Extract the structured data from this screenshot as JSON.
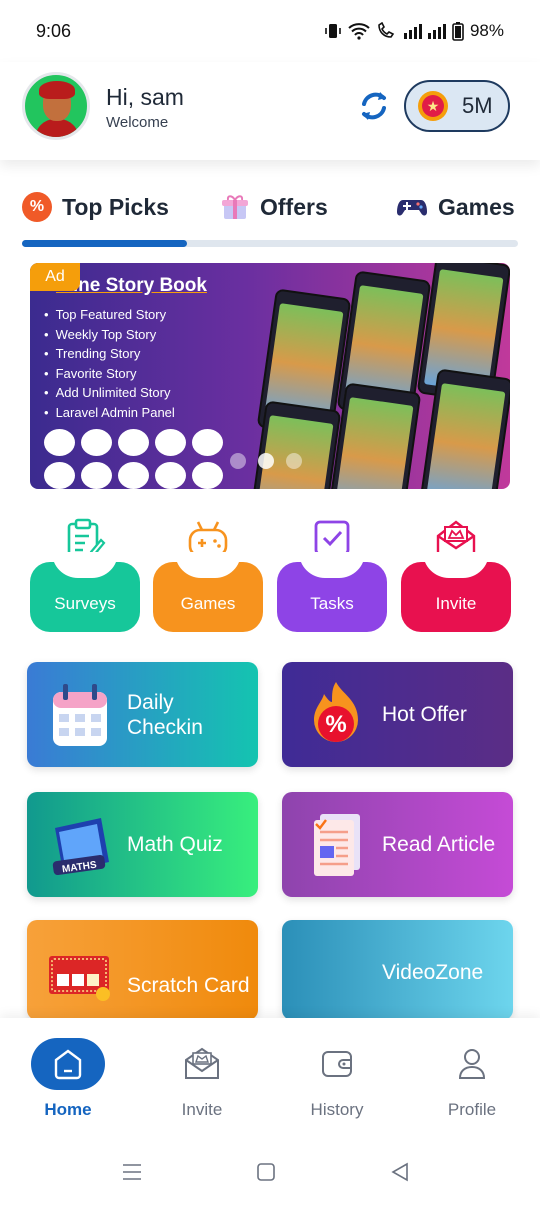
{
  "status_bar": {
    "time": "9:06",
    "battery": "98%"
  },
  "header": {
    "greeting": "Hi, sam",
    "subtitle": "Welcome",
    "coins": "5M"
  },
  "tabs": [
    {
      "label": "Top Picks",
      "icon": "percent-badge-icon",
      "active": true
    },
    {
      "label": "Offers",
      "icon": "gift-icon",
      "active": false
    },
    {
      "label": "Games",
      "icon": "gamepad-icon",
      "active": false
    }
  ],
  "banner": {
    "badge": "Ad",
    "title": "nline Story Book",
    "features": [
      "Top Featured Story",
      "Weekly Top Story",
      "Trending Story",
      "Favorite Story",
      "Add Unlimited Story",
      "Laravel Admin Panel"
    ]
  },
  "quick_actions": [
    {
      "label": "Surveys",
      "color": "#16c79a"
    },
    {
      "label": "Games",
      "color": "#f7931e"
    },
    {
      "label": "Tasks",
      "color": "#8e44e6"
    },
    {
      "label": "Invite",
      "color": "#e8114f"
    }
  ],
  "cards": [
    {
      "label": "Daily Checkin",
      "from": "#3a7bd5",
      "to": "#14c4b0"
    },
    {
      "label": "Hot Offer",
      "from": "#3f2b96",
      "to": "#5b2d86"
    },
    {
      "label": "Math Quiz",
      "from": "#11998e",
      "to": "#38ef7d"
    },
    {
      "label": "Read Article",
      "from": "#8e44ad",
      "to": "#c54bd6"
    },
    {
      "label": "Scratch Card",
      "from": "#f7a13a",
      "to": "#f08a0c"
    },
    {
      "label": "VideoZone",
      "from": "#2b8fb8",
      "to": "#6dd5ed"
    }
  ],
  "bottom_nav": [
    {
      "label": "Home",
      "active": true
    },
    {
      "label": "Invite",
      "active": false
    },
    {
      "label": "History",
      "active": false
    },
    {
      "label": "Profile",
      "active": false
    }
  ]
}
